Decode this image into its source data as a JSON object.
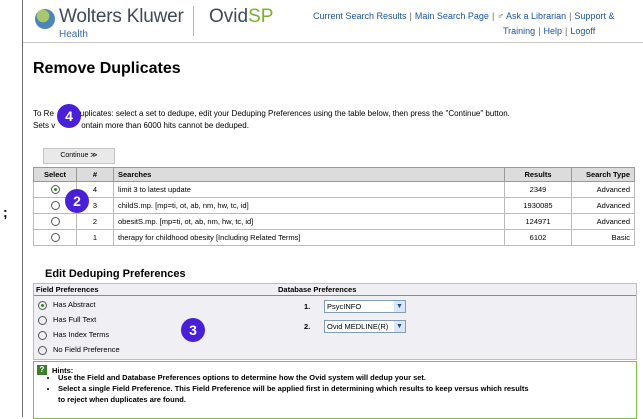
{
  "left_margin": {
    "glyph": ";"
  },
  "header": {
    "brand": "Wolters Kluwer",
    "brand_sub": "Health",
    "product_prefix": "Ovid",
    "product_suffix": "SP",
    "links": [
      "Current Search Results",
      "Main Search Page",
      "Ask a Librarian",
      "Support &"
    ],
    "links2": [
      "Training",
      "Help",
      "Logoff"
    ]
  },
  "page": {
    "title": "Remove Duplicates",
    "instr_line1_a": "To Re",
    "instr_line1_b": "uplicates: select a set to dedupe, edit your Deduping Preferences using the table below, then press the \"Continue\" button.",
    "instr_line2_a": "Sets v",
    "instr_line2_b": "ontain more than 6000 hits cannot be deduped.",
    "continue_label": "Continue ≫"
  },
  "badges": {
    "b4": "4",
    "b2": "2",
    "b3": "3"
  },
  "table": {
    "headers": [
      "Select",
      "#",
      "Searches",
      "Results",
      "Search Type"
    ],
    "rows": [
      {
        "num": "4",
        "search": "limit 3 to latest update",
        "results": "2349",
        "type": "Advanced"
      },
      {
        "num": "3",
        "search": "childS.mp. [mp=ti, ot, ab, nm, hw, tc, id]",
        "results": "1930085",
        "type": "Advanced"
      },
      {
        "num": "2",
        "search": "obesitS.mp. [mp=ti, ot, ab, nm, hw, tc, id]",
        "results": "124971",
        "type": "Advanced"
      },
      {
        "num": "1",
        "search": "therapy for childhood obesity [Including Related Terms]",
        "results": "6102",
        "type": "Basic"
      }
    ]
  },
  "dedup": {
    "title": "Edit Deduping Preferences",
    "field_header": "Field Preferences",
    "db_header": "Database Preferences",
    "field_options": [
      "Has Abstract",
      "Has Full Text",
      "Has Index Terms",
      "No Field Preference"
    ],
    "db1_num": "1.",
    "db1_value": "PsycINFO",
    "db2_num": "2.",
    "db2_value": "Ovid MEDLINE(R)"
  },
  "hints": {
    "title": "Hints:",
    "items": [
      "Use the Field and Database Preferences options to determine how the Ovid system will dedup your set.",
      "Select a single Field Preference. This Field Preference will be applied first in determining which results to keep versus which results",
      "to reject when duplicates are found."
    ]
  }
}
